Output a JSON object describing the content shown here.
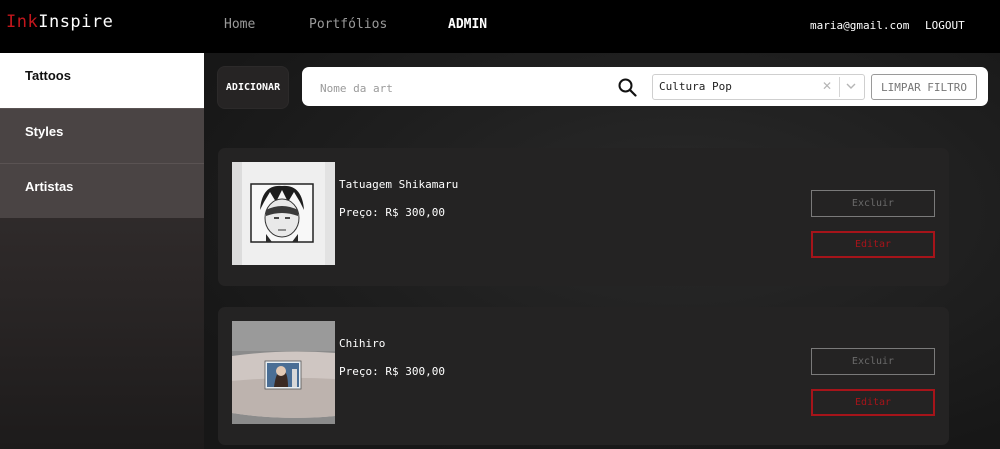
{
  "brand": {
    "part1": "Ink",
    "part2": "Inspire",
    "accent_color": "#c4161c"
  },
  "nav": {
    "home": "Home",
    "portfolios": "Portfólios",
    "admin": "ADMIN"
  },
  "user": {
    "email": "maria@gmail.com",
    "logout": "LOGOUT"
  },
  "sidebar": {
    "items": [
      {
        "label": "Tattoos",
        "active": true
      },
      {
        "label": "Styles",
        "active": false
      },
      {
        "label": "Artistas",
        "active": false
      }
    ]
  },
  "toolbar": {
    "add_label": "ADICIONAR",
    "search_placeholder": "Nome da art",
    "search_icon": "search-icon",
    "filter_value": "Cultura Pop",
    "clear_icon": "close-icon",
    "dropdown_icon": "chevron-down-icon",
    "clear_filter_label": "LIMPAR FILTRO"
  },
  "items": [
    {
      "title": "Tatuagem Shikamaru",
      "price": "Preço: R$ 300,00",
      "delete_label": "Excluir",
      "edit_label": "Editar"
    },
    {
      "title": "Chihiro",
      "price": "Preço: R$ 300,00",
      "delete_label": "Excluir",
      "edit_label": "Editar"
    }
  ]
}
